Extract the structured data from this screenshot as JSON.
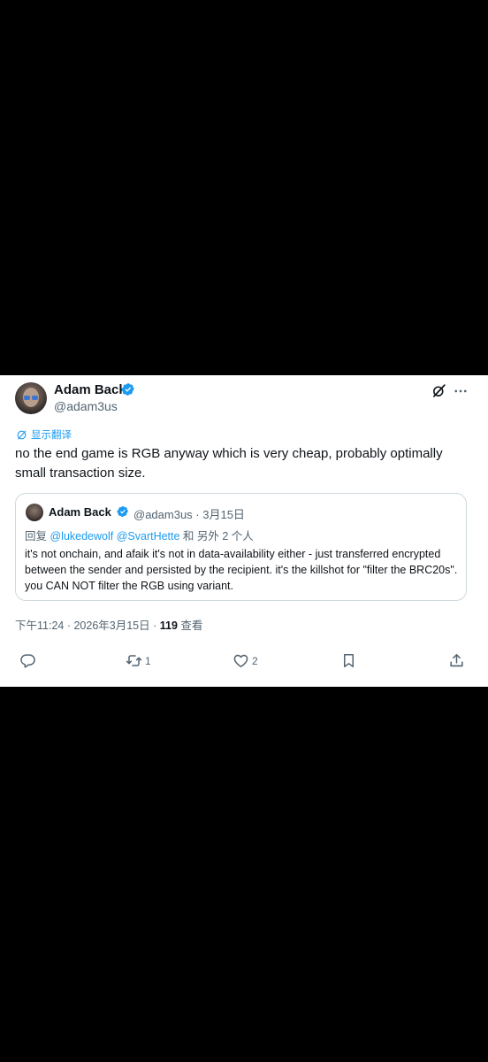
{
  "tweet": {
    "author_name": "Adam Back",
    "author_handle": "@adam3us",
    "translate_label": "显示翻译",
    "text": "no the end game is RGB anyway which is very cheap, probably optimally small transaction size.",
    "timestamp": "下午11:24 · 2026年3月15日 · ",
    "views_count": "119",
    "views_label": " 查看"
  },
  "quote": {
    "author_name": "Adam Back",
    "author_handle": "@adam3us · 3月15日",
    "reply_prefix": "回复 ",
    "reply_mentions": "@lukedewolf @SvartHette",
    "reply_suffix": " 和 另外 2 个人",
    "text": "it's not onchain, and afaik it's not in data-availability either - just transferred encrypted between the sender and persisted by the recipient. it's the killshot for \"filter the BRC20s\". you CAN NOT filter the RGB using variant."
  },
  "actions": {
    "reply_count": "",
    "retweet_count": "1",
    "like_count": "2"
  },
  "colors": {
    "accent": "#1d9bf0",
    "secondary_text": "#536471",
    "border": "#cfd9de"
  }
}
